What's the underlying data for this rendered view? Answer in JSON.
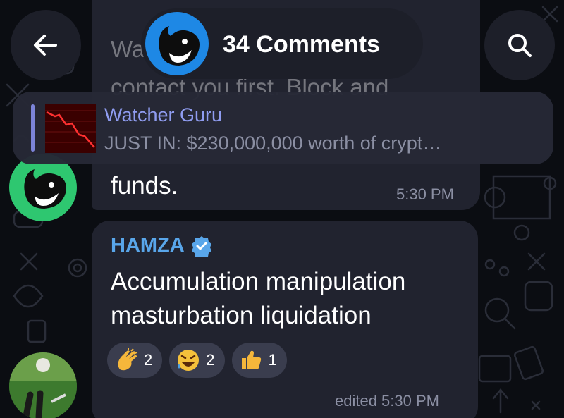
{
  "header": {
    "title": "34 Comments",
    "back_icon": "arrow-left-icon",
    "search_icon": "search-icon"
  },
  "partial_message": {
    "line1_fragment": "Wa",
    "line2_fragment": "contact you first. Block and",
    "last_line": "funds.",
    "time": "5:30 PM"
  },
  "pinned": {
    "channel": "Watcher Guru",
    "preview": "JUST IN: $230,000,000 worth of crypt…"
  },
  "comment": {
    "sender": "HAMZA",
    "line1": "Accumulation manipulation",
    "line2": "masturbation liquidation",
    "time": "edited 5:30 PM",
    "reactions": [
      {
        "emoji": "clapping-hands",
        "count": "2"
      },
      {
        "emoji": "rolling-laughing-face",
        "count": "2"
      },
      {
        "emoji": "thumbs-up",
        "count": "1"
      }
    ]
  },
  "colors": {
    "background": "#0b0d12",
    "bubble": "#21232f",
    "accent": "#59a6ea",
    "pinned_title": "#8f9cf0",
    "channel_avatar": "#1e88e5",
    "whale_avatar": "#2ec770"
  }
}
